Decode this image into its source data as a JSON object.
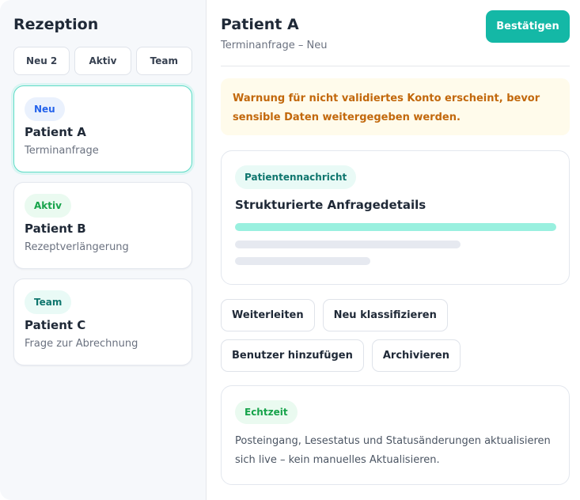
{
  "sidebar": {
    "title": "Rezeption",
    "filters": [
      {
        "label": "Neu 2"
      },
      {
        "label": "Aktiv"
      },
      {
        "label": "Team"
      }
    ],
    "cards": [
      {
        "badge": "Neu",
        "name": "Patient A",
        "subject": "Terminanfrage"
      },
      {
        "badge": "Aktiv",
        "name": "Patient B",
        "subject": "Rezeptverlängerung"
      },
      {
        "badge": "Team",
        "name": "Patient C",
        "subject": "Frage zur Abrechnung"
      }
    ]
  },
  "main": {
    "title": "Patient A",
    "subtitle": "Terminanfrage – Neu",
    "confirm_label": "Bestätigen",
    "warning": "Warnung für nicht validiertes Konto erscheint, bevor sensible Daten weitergegeben werden.",
    "message_panel": {
      "badge": "Patientennachricht",
      "title": "Strukturierte Anfragedetails"
    },
    "actions": [
      {
        "label": "Weiterleiten"
      },
      {
        "label": "Neu klassifizieren"
      },
      {
        "label": "Benutzer hinzufügen"
      },
      {
        "label": "Archivieren"
      }
    ],
    "realtime_panel": {
      "badge": "Echtzeit",
      "text": "Posteingang, Lesestatus und Statusänderungen aktualisieren sich live – kein manuelles Aktualisieren."
    }
  },
  "colors": {
    "accent": "#14b8a6",
    "badge_new": "#2563eb",
    "badge_active": "#16a34a",
    "badge_team": "#0f766e",
    "warning_text": "#c2680c",
    "warning_bg": "#fffbeb"
  }
}
